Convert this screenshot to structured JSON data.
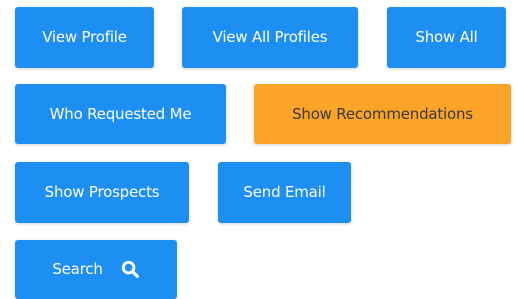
{
  "colors": {
    "primary": "#1e8ff2",
    "highlight": "#fba427"
  },
  "buttons": {
    "view_profile": "View Profile",
    "view_all_profiles": "View All Profiles",
    "show_all": "Show All",
    "who_requested_me": "Who Requested Me",
    "show_recommendations": "Show Recommendations",
    "show_prospects": "Show Prospects",
    "send_email": "Send Email",
    "search": "Search",
    "search_icon": "search-icon"
  }
}
